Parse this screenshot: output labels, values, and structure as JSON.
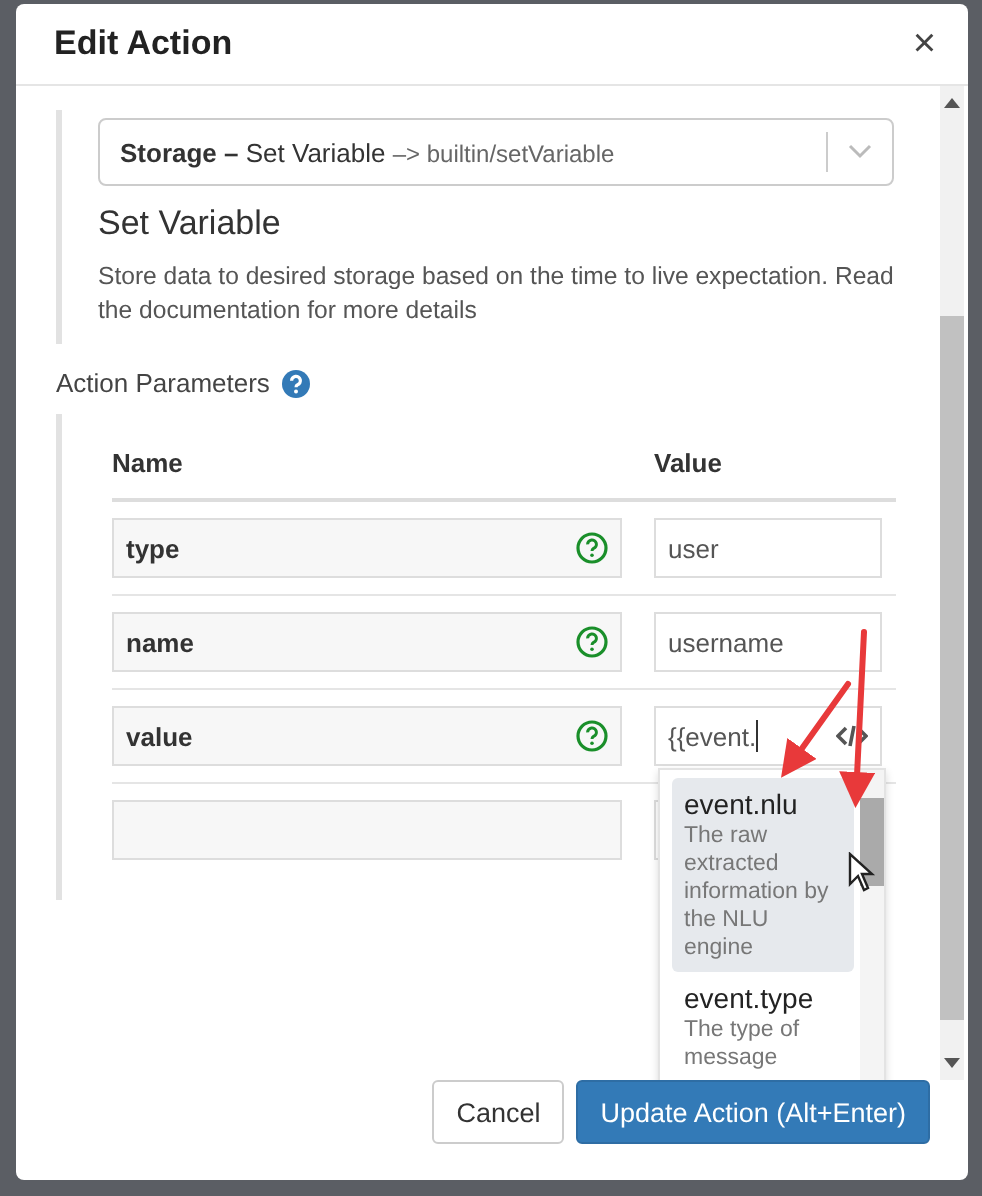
{
  "dialog": {
    "title": "Edit Action",
    "close": "×"
  },
  "action_select": {
    "category": "Storage –",
    "name": "Set Variable",
    "path": "–> builtin/setVariable"
  },
  "action_title": "Set Variable",
  "action_description": "Store data to desired storage based on the time to live expectation. Read the documentation for more details",
  "parameters": {
    "heading": "Action Parameters",
    "columns": [
      "Name",
      "Value"
    ],
    "rows": [
      {
        "kind": "param",
        "name": "type",
        "value": "user"
      },
      {
        "kind": "param",
        "name": "name",
        "value": "username"
      },
      {
        "kind": "code",
        "name": "value",
        "value": "{{event."
      },
      {
        "kind": "empty"
      }
    ]
  },
  "suggestions": [
    {
      "label": "event.nlu",
      "description": "The raw extracted information by the NLU engine",
      "selected": true
    },
    {
      "label": "event.type",
      "description": "The type of message",
      "selected": false
    }
  ],
  "buttons": [
    {
      "label": "Cancel",
      "kind": "secondary"
    },
    {
      "label": "Update Action (Alt+Enter)",
      "kind": "primary"
    }
  ]
}
